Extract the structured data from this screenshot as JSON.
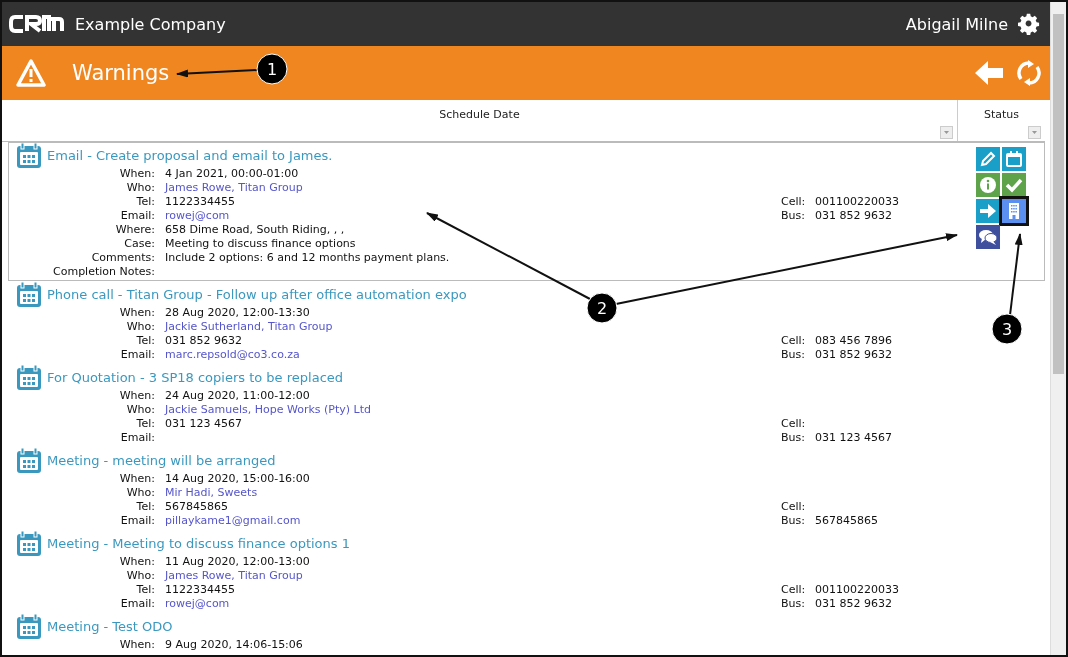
{
  "top_bar": {
    "company": "Example Company",
    "user": "Abigail Milne"
  },
  "title_bar": {
    "title": "Warnings"
  },
  "table": {
    "columns": [
      "Schedule Date",
      "Status"
    ],
    "rows": [
      {
        "title": "Email - Create proposal and email to James.",
        "selected": true,
        "details": [
          {
            "label": "When:",
            "value": "4 Jan 2021, 00:00-01:00",
            "kind": "text"
          },
          {
            "label": "Who:",
            "value": "James Rowe, Titan Group",
            "kind": "link"
          },
          {
            "label": "Tel:",
            "value": "1122334455",
            "kind": "text"
          },
          {
            "label": "Email:",
            "value": "rowej@com",
            "kind": "link"
          },
          {
            "label": "Where:",
            "value": "658 Dime Road, South Riding, , ,",
            "kind": "text"
          },
          {
            "label": "Case:",
            "value": "Meeting to discuss finance options",
            "kind": "text"
          },
          {
            "label": "Comments:",
            "value": "Include 2 options: 6 and 12 months payment plans.",
            "kind": "text"
          },
          {
            "label": "Completion Notes:",
            "kind": "text"
          }
        ],
        "phones": [
          {
            "label": "Cell:",
            "value": "001100220033"
          },
          {
            "label": "Bus:",
            "value": "031 852 9632"
          }
        ],
        "actions": [
          {
            "kind": "edit",
            "color": "#1a9fc8",
            "highlighted": false
          },
          {
            "kind": "calendar",
            "color": "#1a9fc8",
            "highlighted": false
          },
          {
            "kind": "info",
            "color": "#5ea34a",
            "highlighted": false
          },
          {
            "kind": "complete",
            "color": "#5ea34a",
            "highlighted": false
          },
          {
            "kind": "forward",
            "color": "#1a9fc8",
            "highlighted": false
          },
          {
            "kind": "company",
            "color": "#5b8ff0",
            "highlighted": true
          },
          {
            "kind": "comment",
            "color": "#3e4f9e",
            "highlighted": false
          }
        ]
      },
      {
        "title": "Phone call - Titan Group - Follow up after office automation expo",
        "selected": false,
        "details": [
          {
            "label": "When:",
            "value": "28 Aug 2020, 12:00-13:30",
            "kind": "text"
          },
          {
            "label": "Who:",
            "value": "Jackie Sutherland, Titan Group",
            "kind": "link"
          },
          {
            "label": "Tel:",
            "value": "031 852 9632",
            "kind": "text"
          },
          {
            "label": "Email:",
            "value": "marc.repsold@co3.co.za",
            "kind": "link"
          }
        ],
        "phones": [
          {
            "label": "Cell:",
            "value": "083 456 7896"
          },
          {
            "label": "Bus:",
            "value": "031 852 9632"
          }
        ],
        "actions": []
      },
      {
        "title": "For Quotation - 3 SP18 copiers to be replaced",
        "selected": false,
        "details": [
          {
            "label": "When:",
            "value": "24 Aug 2020, 11:00-12:00",
            "kind": "text"
          },
          {
            "label": "Who:",
            "value": "Jackie Samuels, Hope Works (Pty) Ltd",
            "kind": "link"
          },
          {
            "label": "Tel:",
            "value": "031 123 4567",
            "kind": "text"
          },
          {
            "label": "Email:",
            "kind": "link"
          }
        ],
        "phones": [
          {
            "label": "Cell:"
          },
          {
            "label": "Bus:",
            "value": "031 123 4567"
          }
        ],
        "actions": []
      },
      {
        "title": "Meeting - meeting will be arranged",
        "selected": false,
        "details": [
          {
            "label": "When:",
            "value": "14 Aug 2020, 15:00-16:00",
            "kind": "text"
          },
          {
            "label": "Who:",
            "value": "Mir Hadi, Sweets",
            "kind": "link"
          },
          {
            "label": "Tel:",
            "value": "567845865",
            "kind": "text"
          },
          {
            "label": "Email:",
            "value": "pillaykame1@gmail.com",
            "kind": "link"
          }
        ],
        "phones": [
          {
            "label": "Cell:"
          },
          {
            "label": "Bus:",
            "value": "567845865"
          }
        ],
        "actions": []
      },
      {
        "title": "Meeting - Meeting to discuss finance options 1",
        "selected": false,
        "details": [
          {
            "label": "When:",
            "value": "11 Aug 2020, 12:00-13:00",
            "kind": "text"
          },
          {
            "label": "Who:",
            "value": "James Rowe, Titan Group",
            "kind": "link"
          },
          {
            "label": "Tel:",
            "value": "1122334455",
            "kind": "text"
          },
          {
            "label": "Email:",
            "value": "rowej@com",
            "kind": "link"
          }
        ],
        "phones": [
          {
            "label": "Cell:",
            "value": "001100220033"
          },
          {
            "label": "Bus:",
            "value": "031 852 9632"
          }
        ],
        "actions": []
      },
      {
        "title": "Meeting - Test ODO",
        "selected": false,
        "details": [
          {
            "label": "When:",
            "value": "9 Aug 2020, 14:06-15:06",
            "kind": "text"
          }
        ],
        "phones": [],
        "actions": []
      }
    ]
  },
  "callouts": [
    {
      "number": "1"
    },
    {
      "number": "2"
    },
    {
      "number": "3"
    }
  ]
}
